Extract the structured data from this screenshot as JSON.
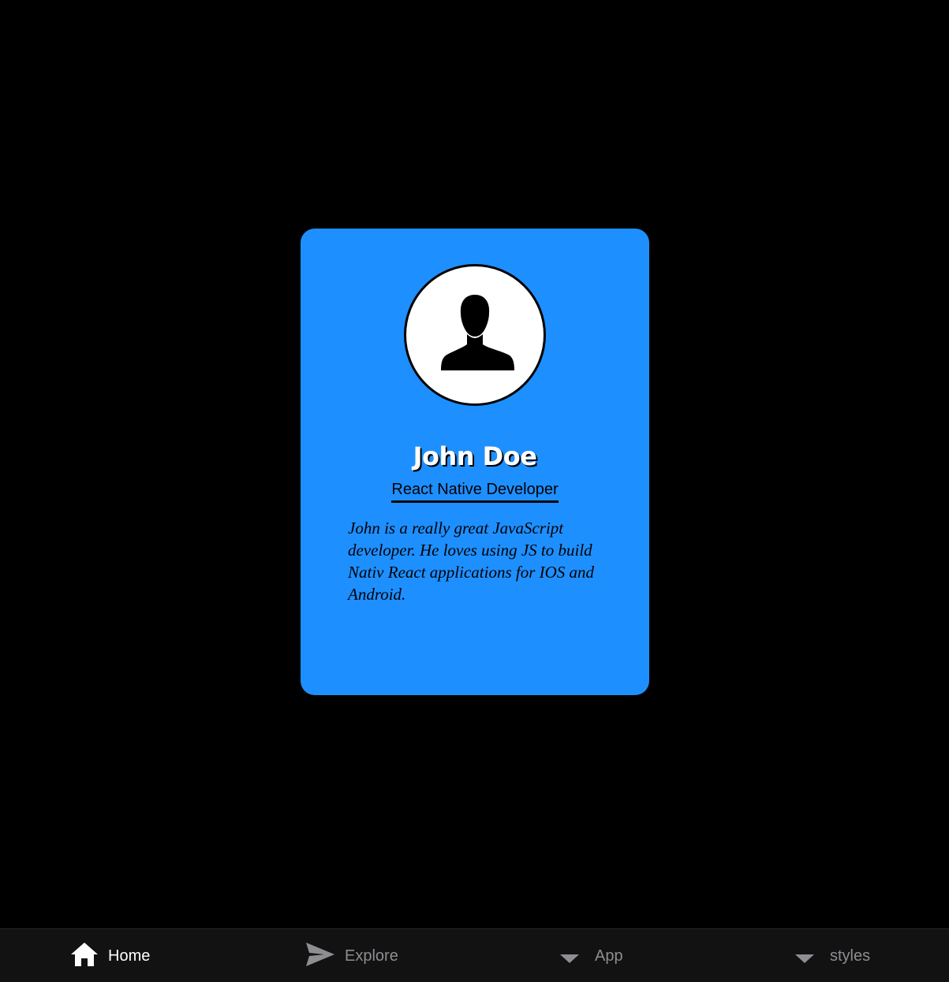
{
  "profile": {
    "name": "John Doe",
    "role": "React Native Developer",
    "bio": "John is a really great JavaScript developer. He loves using JS to build Nativ React applications for IOS and Android.",
    "avatar_icon": "user-silhouette-icon"
  },
  "colors": {
    "background": "#000000",
    "card": "#1e8fff",
    "tabbar": "#121212",
    "tab_active": "#ffffff",
    "tab_inactive": "#8e8e93"
  },
  "tabbar": {
    "active_tab": "Home",
    "tabs": [
      {
        "label": "Home",
        "icon": "home-icon",
        "active": true
      },
      {
        "label": "Explore",
        "icon": "send-icon",
        "active": false
      },
      {
        "label": "App",
        "icon": "caret-down-icon",
        "active": false
      },
      {
        "label": "styles",
        "icon": "caret-down-icon",
        "active": false
      }
    ]
  }
}
